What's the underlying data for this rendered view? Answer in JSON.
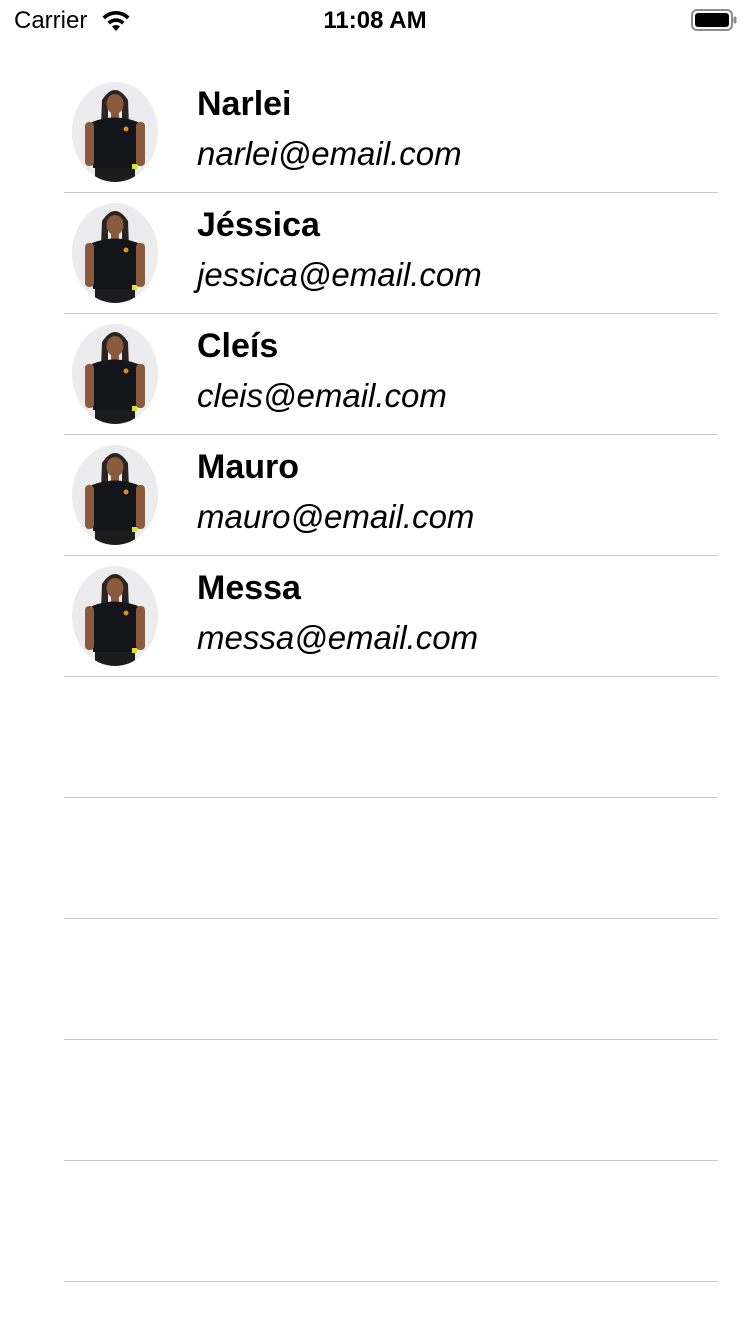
{
  "status_bar": {
    "carrier": "Carrier",
    "time": "11:08 AM",
    "icons": [
      "wifi-icon",
      "battery-icon"
    ]
  },
  "contacts": [
    {
      "name": "Narlei",
      "email": "narlei@email.com"
    },
    {
      "name": "Jéssica",
      "email": "jessica@email.com"
    },
    {
      "name": "Cleís",
      "email": "cleis@email.com"
    },
    {
      "name": "Mauro",
      "email": "mauro@email.com"
    },
    {
      "name": "Messa",
      "email": "messa@email.com"
    }
  ],
  "colors": {
    "separator": "#c8c7cc",
    "text": "#000000",
    "background": "#ffffff"
  }
}
